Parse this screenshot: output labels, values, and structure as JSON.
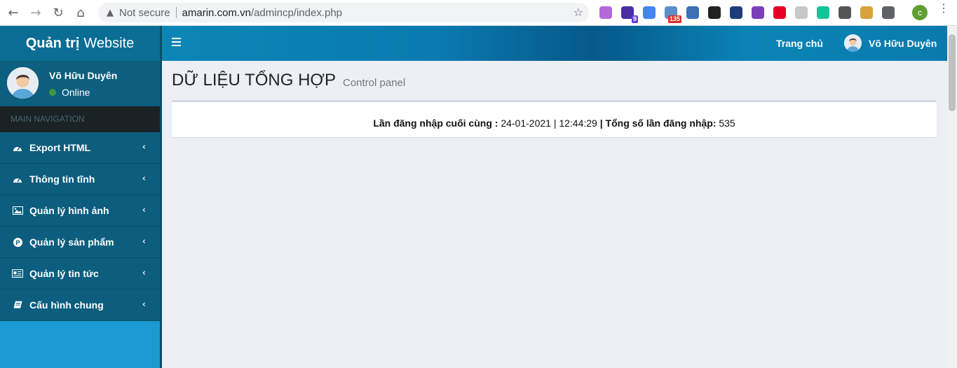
{
  "browser": {
    "security_label": "Not secure",
    "url_host": "amarin.com.vn",
    "url_path": "/admincp/index.php",
    "profile_initial": "c",
    "extensions": [
      {
        "name": "ext-1",
        "color": "#b36ad8",
        "badge": ""
      },
      {
        "name": "ext-2",
        "color": "#4b2ea3",
        "badge": "9"
      },
      {
        "name": "ext-3",
        "color": "#4285f4",
        "badge": ""
      },
      {
        "name": "ext-4",
        "color": "#5b8fc9",
        "badge": "135"
      },
      {
        "name": "ext-5",
        "color": "#3b6fb6",
        "badge": ""
      },
      {
        "name": "ext-6",
        "color": "#222222",
        "badge": ""
      },
      {
        "name": "ext-7",
        "color": "#1c3d7a",
        "badge": ""
      },
      {
        "name": "ext-8",
        "color": "#7b3fb8",
        "badge": ""
      },
      {
        "name": "ext-9",
        "color": "#e60023",
        "badge": ""
      },
      {
        "name": "ext-10",
        "color": "#c8c8c8",
        "badge": ""
      },
      {
        "name": "ext-11",
        "color": "#15c39a",
        "badge": ""
      },
      {
        "name": "ext-12",
        "color": "#555555",
        "badge": ""
      },
      {
        "name": "ext-13",
        "color": "#d9a23a",
        "badge": ""
      },
      {
        "name": "ext-14",
        "color": "#5f6368",
        "badge": ""
      }
    ]
  },
  "sidebar": {
    "logo_bold": "Quản trị",
    "logo_rest": "Website",
    "user_name": "Võ Hữu Duyên",
    "user_status": "Online",
    "nav_header": "MAIN NAVIGATION",
    "items": [
      {
        "label": "Export HTML",
        "icon": "dashboard-icon"
      },
      {
        "label": "Thông tin tĩnh",
        "icon": "dashboard-icon"
      },
      {
        "label": "Quản lý hình ảnh",
        "icon": "image-icon"
      },
      {
        "label": "Quản lý sản phẩm",
        "icon": "product-icon"
      },
      {
        "label": "Quản lý tin tức",
        "icon": "newspaper-icon"
      },
      {
        "label": "Cấu hình chung",
        "icon": "book-icon"
      }
    ]
  },
  "header": {
    "home_link": "Trang chủ",
    "user_name": "Võ Hữu Duyên"
  },
  "content": {
    "title": "DỮ LIỆU TỔNG HỢP",
    "subtitle": "Control panel",
    "last_login_label": "Lần đăng nhập cuối cùng :",
    "last_login_value": "24-01-2021 | 12:44:29",
    "total_login_label": "| Tổng số lần đăng nhập:",
    "total_login_value": "535"
  },
  "colors": {
    "sidebar_bg": "#1a9ad0",
    "menu_bg": "#0c5d7e",
    "nav_header_bg": "#1a2226",
    "status_online": "#3c9a3c"
  }
}
